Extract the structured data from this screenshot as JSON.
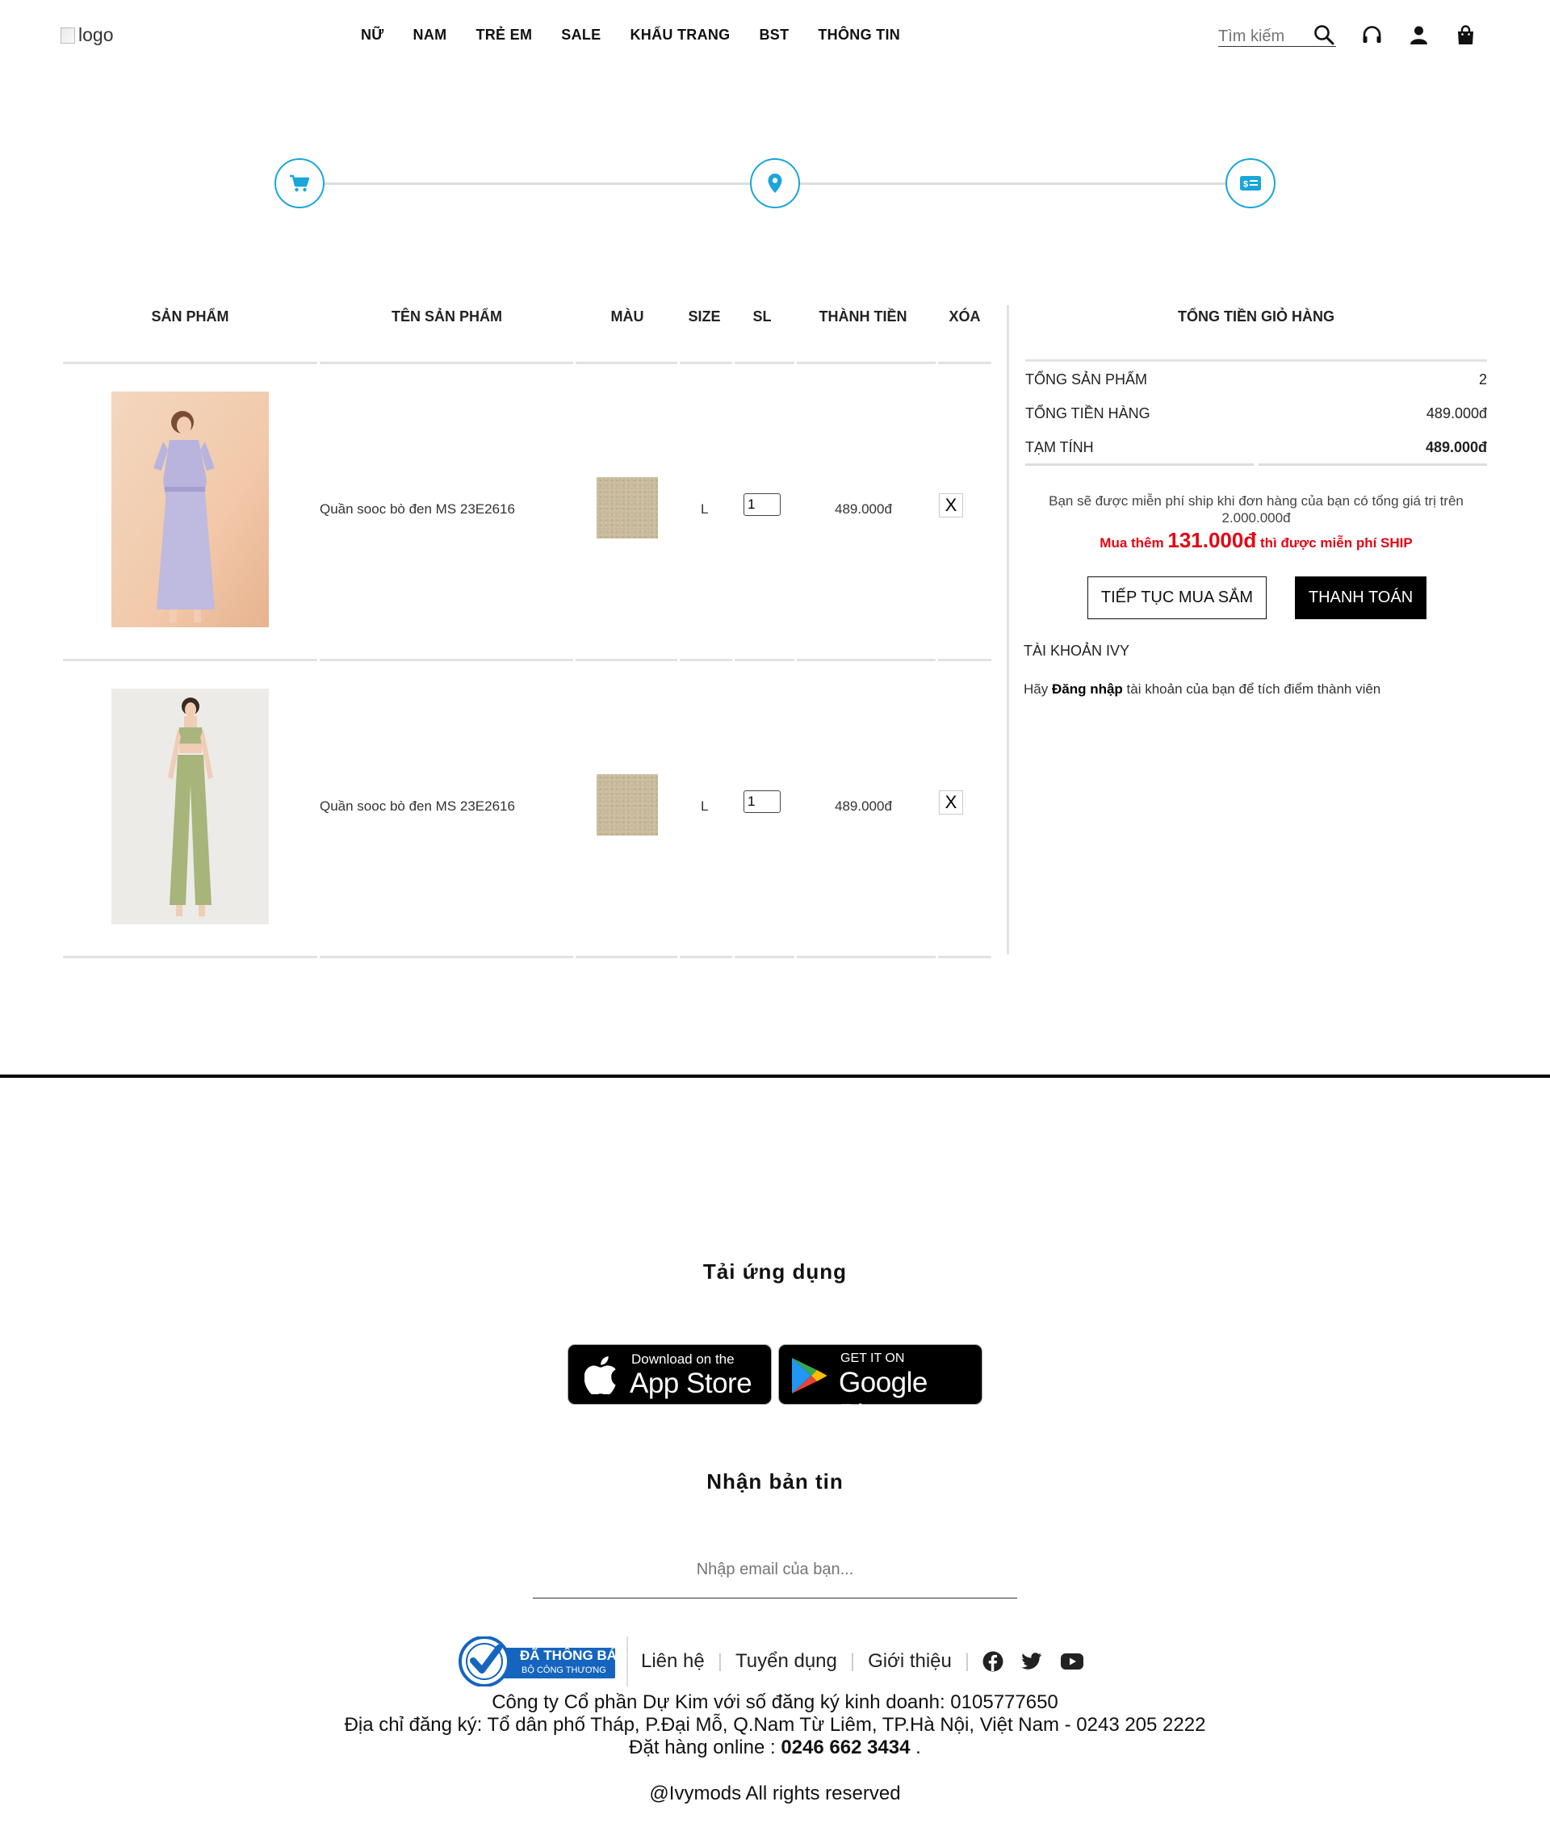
{
  "header": {
    "logo_alt": "logo",
    "nav": [
      "NỮ",
      "NAM",
      "TRẺ EM",
      "SALE",
      "KHẨU TRANG",
      "BST",
      "THÔNG TIN"
    ],
    "search_placeholder": "Tìm kiếm"
  },
  "cart": {
    "columns": [
      "SẢN PHẨM",
      "TÊN SẢN PHẨM",
      "MÀU",
      "SIZE",
      "SL",
      "THÀNH TIỀN",
      "XÓA"
    ],
    "items": [
      {
        "name": "Quần sooc bò đen MS 23E2616",
        "size": "L",
        "qty": "1",
        "price": "489.000đ",
        "delete_label": "X",
        "swatch_color": "#c8b99a",
        "image": "lavender-dress-photo"
      },
      {
        "name": "Quần sooc bò đen MS 23E2616",
        "size": "L",
        "qty": "1",
        "price": "489.000đ",
        "delete_label": "X",
        "swatch_color": "#c8b99a",
        "image": "green-set-photo"
      }
    ]
  },
  "summary": {
    "title": "TỔNG TIỀN GIỎ HÀNG",
    "rows": [
      {
        "label": "TỔNG SẢN PHẨM",
        "value": "2"
      },
      {
        "label": "TỔNG TIỀN HÀNG",
        "value": "489.000đ"
      },
      {
        "label": "TẠM TÍNH",
        "value": "489.000đ"
      }
    ],
    "free_ship_note": "Bạn sẽ được miễn phí ship khi đơn hàng của bạn có tổng giá trị trên 2.000.000đ",
    "promo_prefix": "Mua thêm",
    "promo_amount": "131.000đ",
    "promo_suffix": "thì được miễn phí SHIP",
    "continue_button": "TIẾP TỤC MUA SẮM",
    "checkout_button": "THANH TOÁN",
    "account_title": "TÀI KHOẢN IVY",
    "account_text_prefix": "Hãy",
    "account_login_link": "Đăng nhập",
    "account_text_suffix": "tài khoản của bạn để tích điểm thành viên"
  },
  "footer": {
    "app_heading": "Tải ứng dụng",
    "appstore_small": "Download on the",
    "appstore_big": "App Store",
    "googleplay_small": "GET IT ON",
    "googleplay_big": "Google Play",
    "newsletter_heading": "Nhận bản tin",
    "email_placeholder": "Nhập email của bạn...",
    "badge_line1": "ĐÃ THÔNG BÁO",
    "badge_line2": "BỘ CÔNG THƯƠNG",
    "links": [
      "Liên hệ",
      "Tuyển dụng",
      "Giới thiệu"
    ],
    "company": "Công ty Cổ phần Dự Kim với số đăng ký kinh doanh: 0105777650",
    "address": "Địa chỉ đăng ký: Tổ dân phố Tháp, P.Đại Mỗ, Q.Nam Từ Liêm, TP.Hà Nội, Việt Nam - 0243 205 2222",
    "order_prefix": "Đặt hàng online :",
    "order_phone": "0246 662 3434",
    "order_suffix": ".",
    "copyright": "@Ivymods All rights reserved"
  },
  "colors": {
    "accent": "#19a6db",
    "promo": "#e30613",
    "badge": "#1565c0"
  }
}
